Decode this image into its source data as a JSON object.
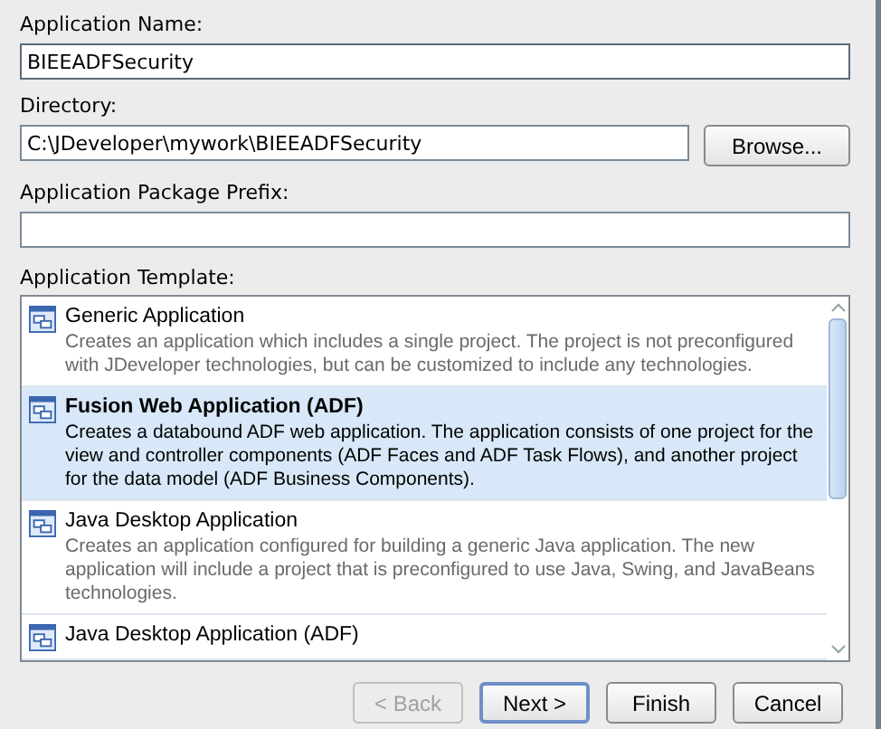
{
  "fields": [
    {
      "label": "Application Name:",
      "value": "BIEEADFSecurity",
      "focused": true
    },
    {
      "label": "Directory:",
      "value": "C:\\JDeveloper\\mywork\\BIEEADFSecurity",
      "button": "Browse..."
    },
    {
      "label": "Application Package Prefix:"
    }
  ],
  "templates": {
    "label": "Application Template:",
    "items": [
      {
        "title": "Generic Application",
        "description": "Creates an application which includes a single project. The project is not preconfigured with JDeveloper technologies, but can be customized to include any technologies.",
        "selected": false
      },
      {
        "title": "Fusion Web Application (ADF)",
        "description": "Creates a databound ADF web application. The application consists of one project for the view and controller components (ADF Faces and ADF Task Flows), and another project for the data model (ADF Business Components).",
        "selected": true
      },
      {
        "title": "Java Desktop Application",
        "description": "Creates an application configured for building a generic Java application. The new application will include a project that is preconfigured to use Java, Swing, and JavaBeans technologies.",
        "selected": false
      },
      {
        "title": "Java Desktop Application (ADF)",
        "selected": false
      }
    ]
  },
  "buttons": [
    {
      "label": "< Back",
      "disabled": true,
      "default": false
    },
    {
      "label": "Next >",
      "disabled": false,
      "default": true
    },
    {
      "label": "Finish",
      "disabled": false,
      "default": false
    },
    {
      "label": "Cancel",
      "disabled": false,
      "default": false
    }
  ]
}
